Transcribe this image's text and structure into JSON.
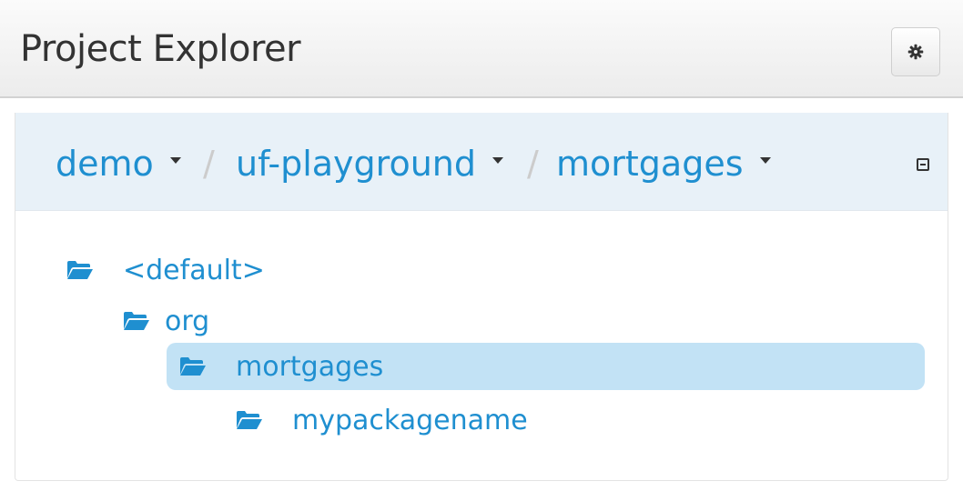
{
  "header": {
    "title": "Project Explorer",
    "settings_icon": "gear-icon"
  },
  "breadcrumb": {
    "items": [
      {
        "label": "demo",
        "icon": "caret-down-icon"
      },
      {
        "label": "uf-playground",
        "icon": "caret-down-icon"
      },
      {
        "label": "mortgages",
        "icon": "caret-down-icon"
      }
    ],
    "separator": "/",
    "collapse_icon": "collapse-icon"
  },
  "tree": {
    "items": [
      {
        "label": "<default>",
        "icon": "folder-open-icon",
        "selected": false
      },
      {
        "label": "org",
        "icon": "folder-open-icon",
        "selected": false
      },
      {
        "label": "mortgages",
        "icon": "folder-open-icon",
        "selected": true
      },
      {
        "label": "mypackagename",
        "icon": "folder-open-icon",
        "selected": false
      }
    ]
  },
  "colors": {
    "link": "#1f8fd0",
    "selected_bg": "#c2e2f5",
    "heading_bg": "#e8f1f8"
  }
}
